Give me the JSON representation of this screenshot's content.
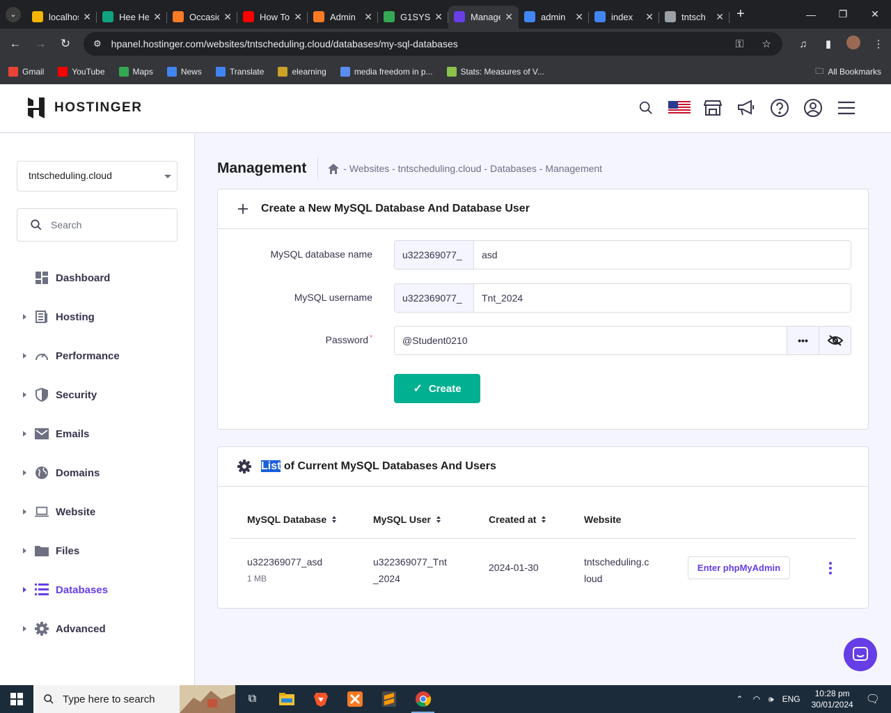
{
  "browser": {
    "tabs": [
      {
        "title": "localhost",
        "fav_color": "#f4b400",
        "active": false
      },
      {
        "title": "Hee Hee",
        "fav_color": "#10a37f",
        "active": false
      },
      {
        "title": "Occasions",
        "fav_color": "#fb7a24",
        "active": false
      },
      {
        "title": "How To",
        "fav_color": "#ff0000",
        "active": false
      },
      {
        "title": "Admin",
        "fav_color": "#fb7a24",
        "active": false
      },
      {
        "title": "G1SYS",
        "fav_color": "#34a853",
        "active": false
      },
      {
        "title": "Manage",
        "fav_color": "#673de6",
        "active": true
      },
      {
        "title": "admin",
        "fav_color": "#4285f4",
        "active": false
      },
      {
        "title": "index",
        "fav_color": "#4285f4",
        "active": false
      },
      {
        "title": "tntsch",
        "fav_color": "#9aa0a6",
        "active": false
      }
    ],
    "url": "hpanel.hostinger.com/websites/tntscheduling.cloud/databases/my-sql-databases",
    "bookmarks": [
      {
        "label": "Gmail",
        "color": "#ea4335"
      },
      {
        "label": "YouTube",
        "color": "#ff0000"
      },
      {
        "label": "Maps",
        "color": "#34a853"
      },
      {
        "label": "News",
        "color": "#4285f4"
      },
      {
        "label": "Translate",
        "color": "#4285f4"
      },
      {
        "label": "elearning",
        "color": "#c9a227"
      },
      {
        "label": "media freedom in p...",
        "color": "#5b8def"
      },
      {
        "label": "Stats: Measures of V...",
        "color": "#8bc34a"
      }
    ],
    "all_bookmarks": "All Bookmarks"
  },
  "header": {
    "brand": "HOSTINGER",
    "icons": [
      "search-icon",
      "us-flag-icon",
      "store-icon",
      "megaphone-icon",
      "help-icon",
      "account-icon",
      "menu-icon"
    ]
  },
  "sidebar": {
    "domain": "tntscheduling.cloud",
    "search_placeholder": "Search",
    "items": [
      {
        "label": "Dashboard",
        "icon": "dashboard-icon",
        "has_arrow": false
      },
      {
        "label": "Hosting",
        "icon": "hosting-icon",
        "has_arrow": true
      },
      {
        "label": "Performance",
        "icon": "performance-icon",
        "has_arrow": true
      },
      {
        "label": "Security",
        "icon": "shield-icon",
        "has_arrow": true
      },
      {
        "label": "Emails",
        "icon": "mail-icon",
        "has_arrow": true
      },
      {
        "label": "Domains",
        "icon": "globe-icon",
        "has_arrow": true
      },
      {
        "label": "Website",
        "icon": "laptop-icon",
        "has_arrow": true
      },
      {
        "label": "Files",
        "icon": "folder-icon",
        "has_arrow": true
      },
      {
        "label": "Databases",
        "icon": "database-icon",
        "has_arrow": true,
        "active": true
      },
      {
        "label": "Advanced",
        "icon": "gear-icon",
        "has_arrow": true
      }
    ]
  },
  "main": {
    "title": "Management",
    "breadcrumb": "- Websites - tntscheduling.cloud - Databases - Management",
    "create_card": {
      "title": "Create a New MySQL Database And Database User",
      "fields": [
        {
          "label": "MySQL database name",
          "prefix": "u322369077_",
          "value": "asd"
        },
        {
          "label": "MySQL username",
          "prefix": "u322369077_",
          "value": "Tnt_2024"
        }
      ],
      "password_label": "Password",
      "password_required_mark": "*",
      "password_value": "@Student0210",
      "generate_label": "•••",
      "create_label": "Create"
    },
    "list_card": {
      "title_highlight": "List",
      "title_rest": " of Current MySQL Databases And Users",
      "columns": [
        "MySQL Database",
        "MySQL User",
        "Created at",
        "Website"
      ],
      "rows": [
        {
          "database": "u322369077_asd",
          "size": "1 MB",
          "user_line1": "u322369077_Tnt",
          "user_line2": "_2024",
          "created": "2024-01-30",
          "website_line1": "tntscheduling.c",
          "website_line2": "loud",
          "action": "Enter phpMyAdmin"
        }
      ]
    }
  },
  "taskbar": {
    "search_placeholder": "Type here to search",
    "lang": "ENG",
    "time": "10:28 pm",
    "date": "30/01/2024"
  },
  "colors": {
    "brand_purple": "#673de6",
    "create_green": "#00b090",
    "highlight_blue": "#1a5fdb"
  }
}
